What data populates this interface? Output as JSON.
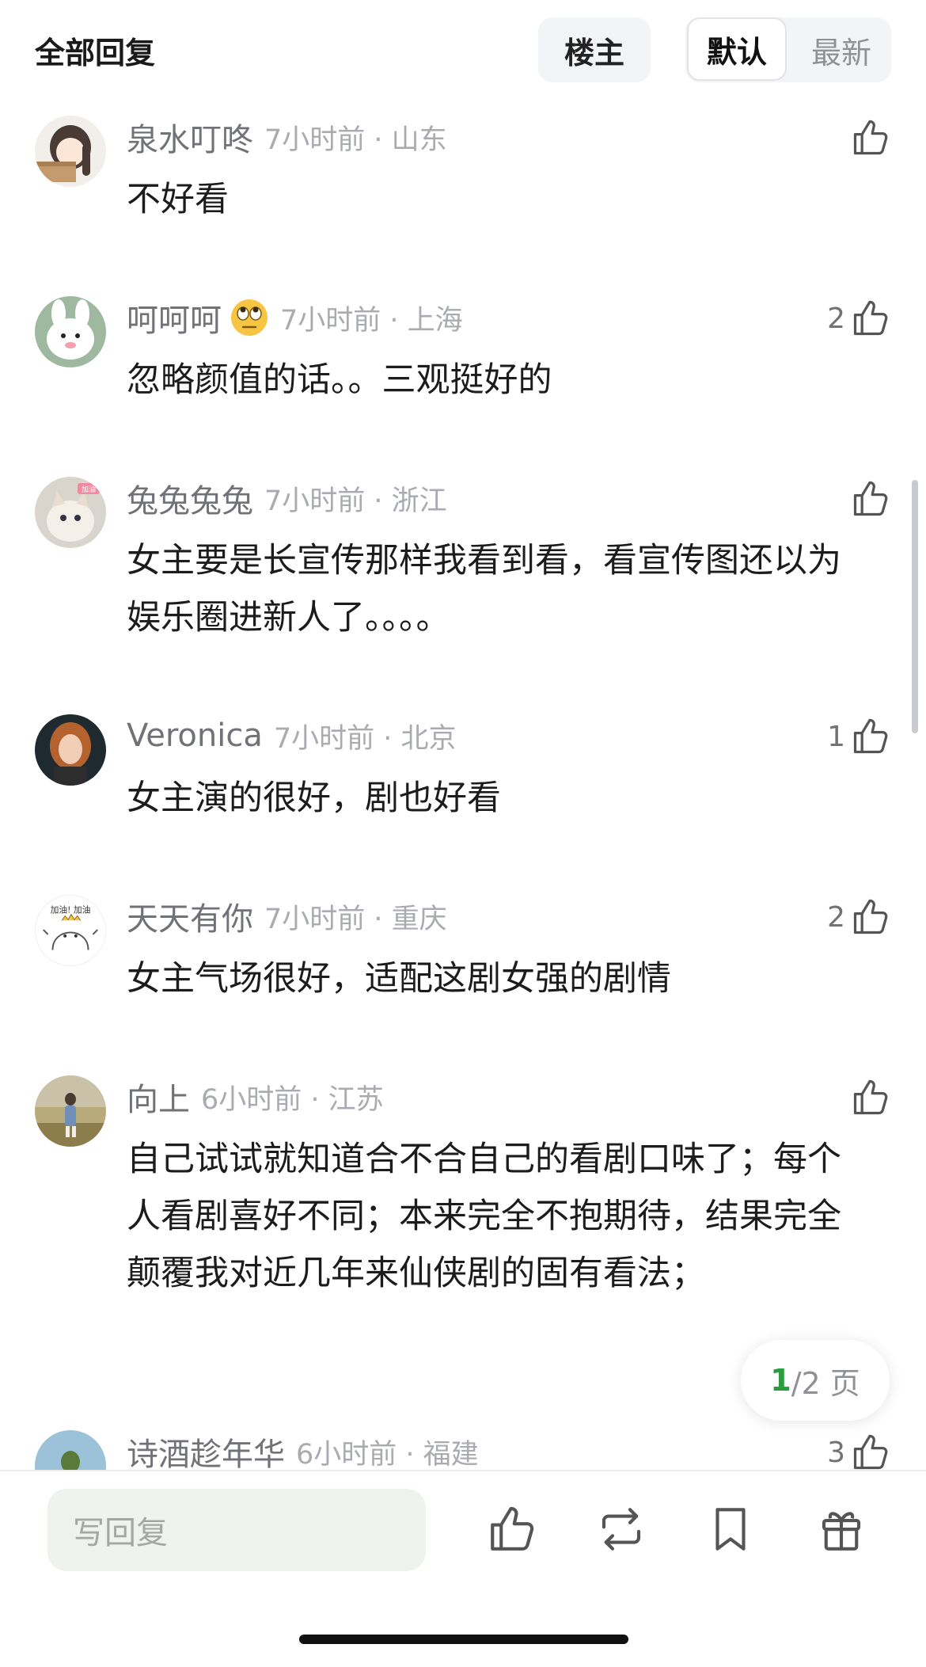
{
  "header": {
    "title": "全部回复",
    "louzhu_label": "楼主",
    "sort_default_label": "默认",
    "sort_latest_label": "最新"
  },
  "comments": [
    {
      "username": "泉水叮咚",
      "time": "7小时前 · 山东",
      "text": "不好看",
      "likes": ""
    },
    {
      "username": "呵呵呵",
      "time": "7小时前 · 上海",
      "text": "忽略颜值的话。。三观挺好的",
      "likes": "2"
    },
    {
      "username": "兔兔兔兔",
      "time": "7小时前 · 浙江",
      "text": "女主要是长宣传那样我看到看，看宣传图还以为娱乐圈进新人了。。。。",
      "likes": ""
    },
    {
      "username": "Veronica",
      "time": "7小时前 · 北京",
      "text": "女主演的很好，剧也好看",
      "likes": "1"
    },
    {
      "username": "天天有你",
      "time": "7小时前 · 重庆",
      "text": "女主气场很好，适配这剧女强的剧情",
      "likes": "2"
    },
    {
      "username": "向上",
      "time": "6小时前 · 江苏",
      "text": "自己试试就知道合不合自己的看剧口味了；每个人看剧喜好不同；本来完全不抱期待，结果完全颠覆我对近几年来仙侠剧的固有看法；",
      "likes": ""
    },
    {
      "username": "诗酒趁年华",
      "time": "6小时前 · 福建",
      "text": "",
      "likes": "3"
    }
  ],
  "avatar_badges": {
    "c2": "加油",
    "c4": "加油! 加油"
  },
  "pagination": {
    "current": "1",
    "rest": "/2 页"
  },
  "bottom_bar": {
    "reply_placeholder": "写回复"
  },
  "colors": {
    "accent_green": "#2a9d3e",
    "input_bg": "#eef3ee",
    "username": "#707278",
    "meta": "#a9abb0"
  }
}
